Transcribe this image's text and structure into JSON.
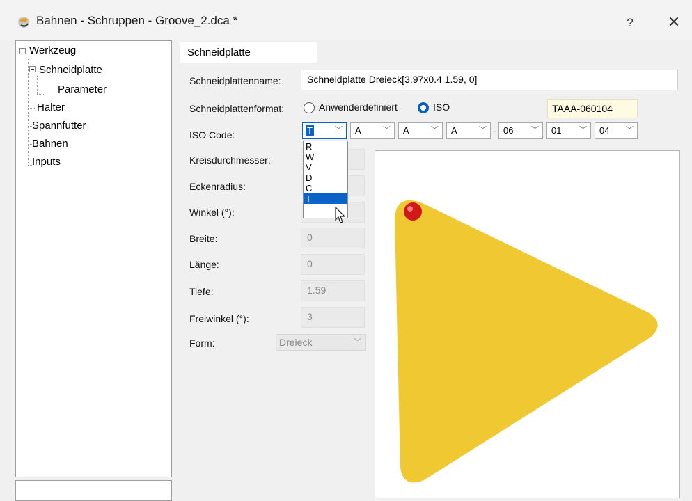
{
  "window": {
    "title": "Bahnen - Schruppen - Groove_2.dca *",
    "help_label": "?",
    "close_label": "✕"
  },
  "tree": {
    "items": [
      {
        "label": "Werkzeug"
      },
      {
        "label": "Schneidplatte"
      },
      {
        "label": "Parameter"
      },
      {
        "label": "Halter"
      },
      {
        "label": "Spannfutter"
      },
      {
        "label": "Bahnen"
      },
      {
        "label": "Inputs"
      }
    ]
  },
  "tab": {
    "label": "Schneidplatte"
  },
  "form": {
    "name_label": "Schneidplattenname:",
    "name_value": "Schneidplatte Dreieck[3.97x0.4 1.59, 0]",
    "format_label": "Schneidplattenformat:",
    "format_option_custom": "Anwenderdefiniert",
    "format_option_iso": "ISO",
    "iso_code_value": "TAAA-060104",
    "iso_label": "ISO Code:",
    "iso_combos": [
      "T",
      "A",
      "A",
      "A",
      "06",
      "01",
      "04"
    ],
    "iso_separator": "-",
    "kreis_label": "Kreisdurchmesser:",
    "ecken_label": "Eckenradius:",
    "winkel_label": "Winkel (°):",
    "breite_label": "Breite:",
    "breite_value": "0",
    "laenge_label": "Länge:",
    "laenge_value": "0",
    "tiefe_label": "Tiefe:",
    "tiefe_value": "1.59",
    "freiwinkel_label": "Freiwinkel  (°):",
    "freiwinkel_value": "3",
    "form_label": "Form:",
    "form_value": "Dreieck"
  },
  "dropdown": {
    "options": [
      "R",
      "W",
      "V",
      "D",
      "C",
      "T"
    ],
    "highlighted": "T"
  },
  "colors": {
    "insert_fill": "#f0c832",
    "marker": "#cc1111",
    "selection": "#0a64c8"
  }
}
